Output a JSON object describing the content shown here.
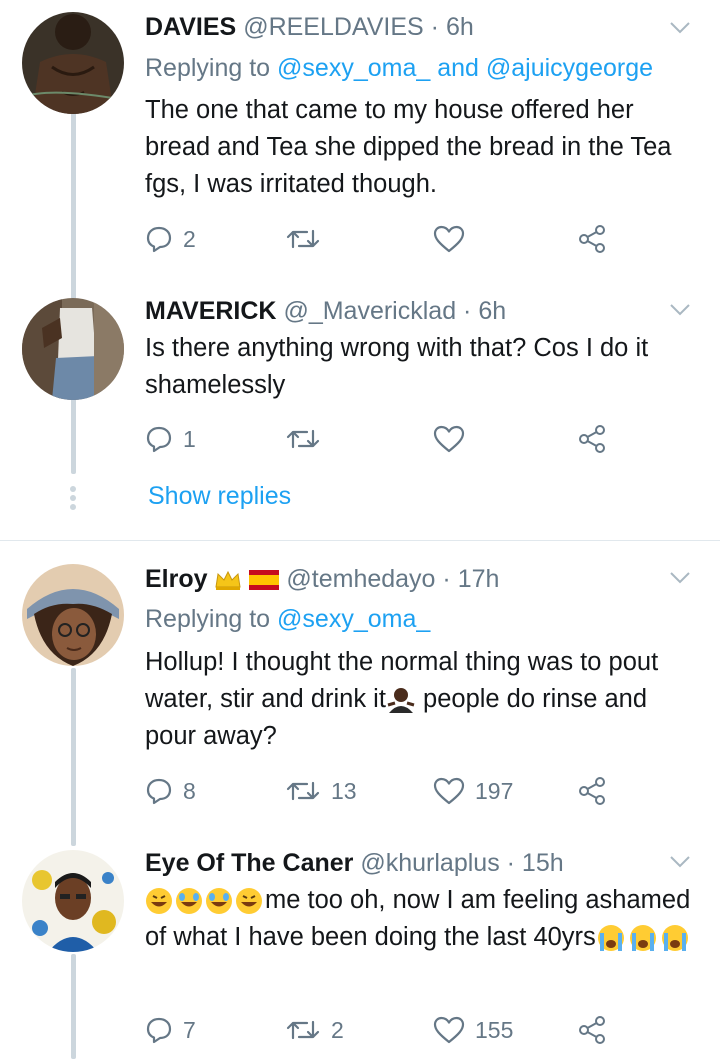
{
  "tweets": [
    {
      "name": "DAVIES",
      "handle": "@REELDAVIES",
      "time": "· 6h",
      "reply_prefix": "Replying to ",
      "reply_mention1": "@sexy_oma_",
      "reply_and": " and ",
      "reply_mention2": "@ajuicygeorge",
      "text": "The one that came to my house offered her bread and Tea she dipped the bread in the Tea fgs, I was irritated though.",
      "replies": "2",
      "retweets": "",
      "likes": ""
    },
    {
      "name": "MAVERICK",
      "handle": "@_Mavericklad",
      "time": "· 6h",
      "text": "Is there anything wrong with that? Cos I do it shamelessly",
      "replies": "1",
      "retweets": "",
      "likes": ""
    },
    {
      "name": "Elroy",
      "handle": "@temhedayo",
      "time": "· 17h",
      "reply_prefix": "Replying to ",
      "reply_mention1": "@sexy_oma_",
      "text_part1": "Hollup! I thought the normal thing was to pout water, stir and drink it",
      "text_part2": " people do rinse and pour away?",
      "replies": "8",
      "retweets": "13",
      "likes": "197"
    },
    {
      "name": "Eye Of The Caner",
      "handle": "@khurlaplus",
      "time": "· 15h",
      "text_part1": "me too oh, now I am feeling ashamed of what I have been doing the last 40yrs",
      "replies": "7",
      "retweets": "2",
      "likes": "155"
    }
  ],
  "show_replies": "Show replies",
  "colors": {
    "accent": "#1da1f2",
    "muted": "#657786",
    "line": "#ccd6dd"
  },
  "icons": [
    "reply-icon",
    "retweet-icon",
    "like-icon",
    "share-icon",
    "chevron-down-icon"
  ]
}
